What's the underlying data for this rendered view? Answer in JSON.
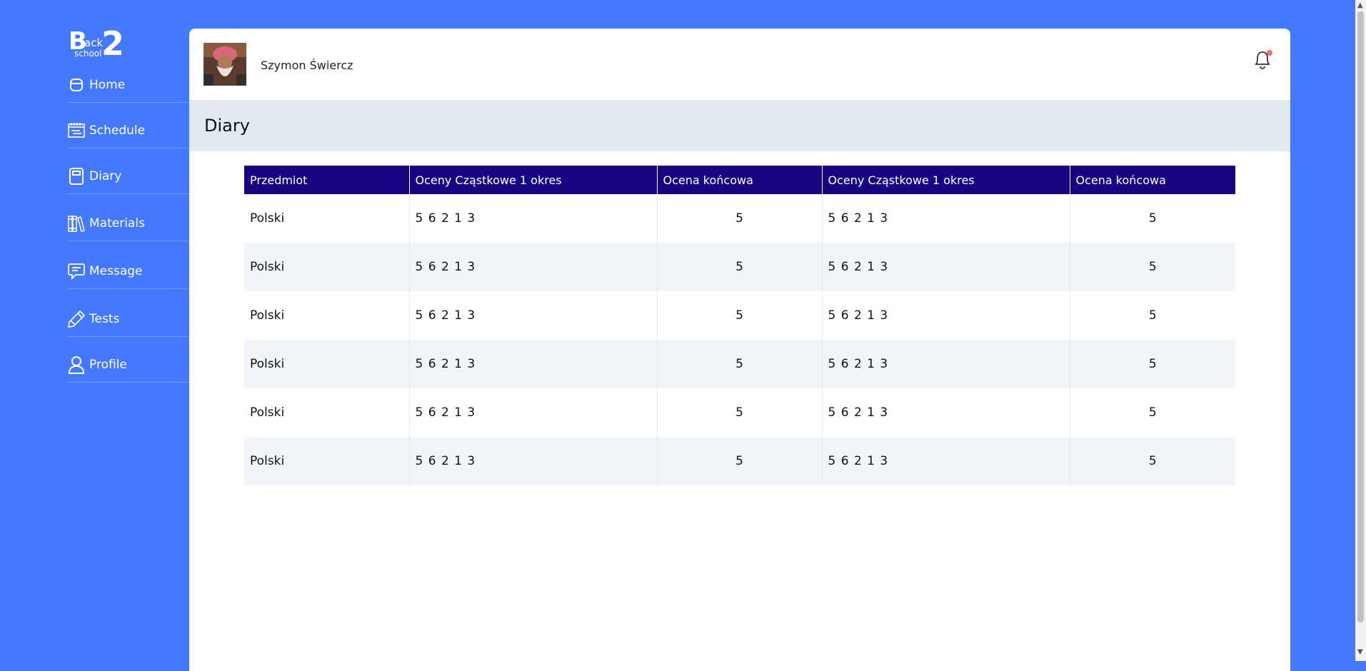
{
  "logo": {
    "b": "B",
    "ack": "ack",
    "school": "school",
    "two": "2"
  },
  "sidebar": {
    "items": [
      {
        "label": "Home",
        "icon": "home-icon"
      },
      {
        "label": "Schedule",
        "icon": "calendar-icon"
      },
      {
        "label": "Diary",
        "icon": "notebook-icon"
      },
      {
        "label": "Materials",
        "icon": "books-icon"
      },
      {
        "label": "Message",
        "icon": "chat-bubble-icon"
      },
      {
        "label": "Tests",
        "icon": "pencil-icon"
      },
      {
        "label": "Profile",
        "icon": "user-icon"
      }
    ]
  },
  "header": {
    "user_name": "Szymon Świercz",
    "notification_icon": "bell-icon",
    "has_notification": true
  },
  "page": {
    "title": "Diary"
  },
  "table": {
    "headers": [
      "Przedmiot",
      "Oceny Cząstkowe 1 okres",
      "Ocena końcowa",
      "Oceny Cząstkowe 1 okres",
      "Ocena końcowa"
    ],
    "rows": [
      [
        "Polski",
        "5 6 2 1 3",
        "5",
        "5 6 2 1 3",
        "5"
      ],
      [
        "Polski",
        "5 6 2 1 3",
        "5",
        "5 6 2 1 3",
        "5"
      ],
      [
        "Polski",
        "5 6 2 1 3",
        "5",
        "5 6 2 1 3",
        "5"
      ],
      [
        "Polski",
        "5 6 2 1 3",
        "5",
        "5 6 2 1 3",
        "5"
      ],
      [
        "Polski",
        "5 6 2 1 3",
        "5",
        "5 6 2 1 3",
        "5"
      ],
      [
        "Polski",
        "5 6 2 1 3",
        "5",
        "5 6 2 1 3",
        "5"
      ]
    ]
  },
  "colors": {
    "background": "#4479FF",
    "table_header": "#160480",
    "title_bar": "#E1E9F1",
    "row_alt": "#F1F5F9",
    "notification_dot": "#F06C6C"
  }
}
